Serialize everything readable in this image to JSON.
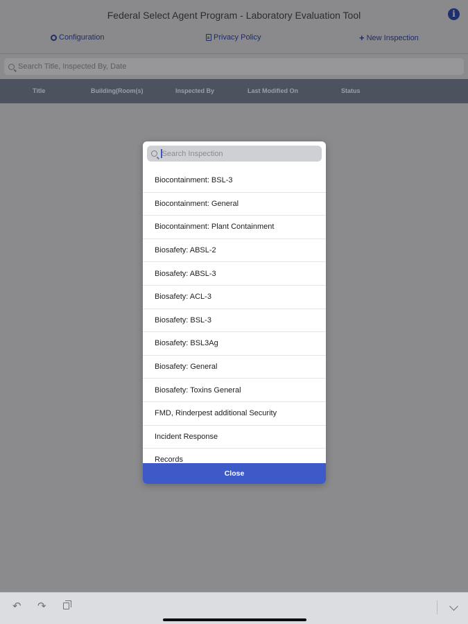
{
  "app": {
    "title": "Federal Select Agent Program - Laboratory Evaluation Tool",
    "info_icon": "info-icon"
  },
  "nav": {
    "configuration": "Configuration",
    "privacy_policy": "Privacy Policy",
    "new_inspection": "New Inspection"
  },
  "search": {
    "placeholder": "Search Title, Inspected By, Date"
  },
  "table": {
    "columns": [
      "Title",
      "Building(Room(s)",
      "Inspected By",
      "Last Modified On",
      "Status"
    ]
  },
  "modal": {
    "search_placeholder": "Search Inspection",
    "items": [
      "Biocontainment: BSL-3",
      "Biocontainment: General",
      "Biocontainment: Plant Containment",
      "Biosafety: ABSL-2",
      "Biosafety: ABSL-3",
      "Biosafety: ACL-3",
      "Biosafety: BSL-3",
      "Biosafety: BSL3Ag",
      "Biosafety: General",
      "Biosafety: Toxins General",
      "FMD, Rinderpest additional Security",
      "Incident Response",
      "Records"
    ],
    "close_label": "Close"
  },
  "colors": {
    "overlay": "#8b8b8d",
    "table_header": "#4c535f",
    "accent": "#3e5ac8",
    "nav_text": "#1e2c6a"
  }
}
